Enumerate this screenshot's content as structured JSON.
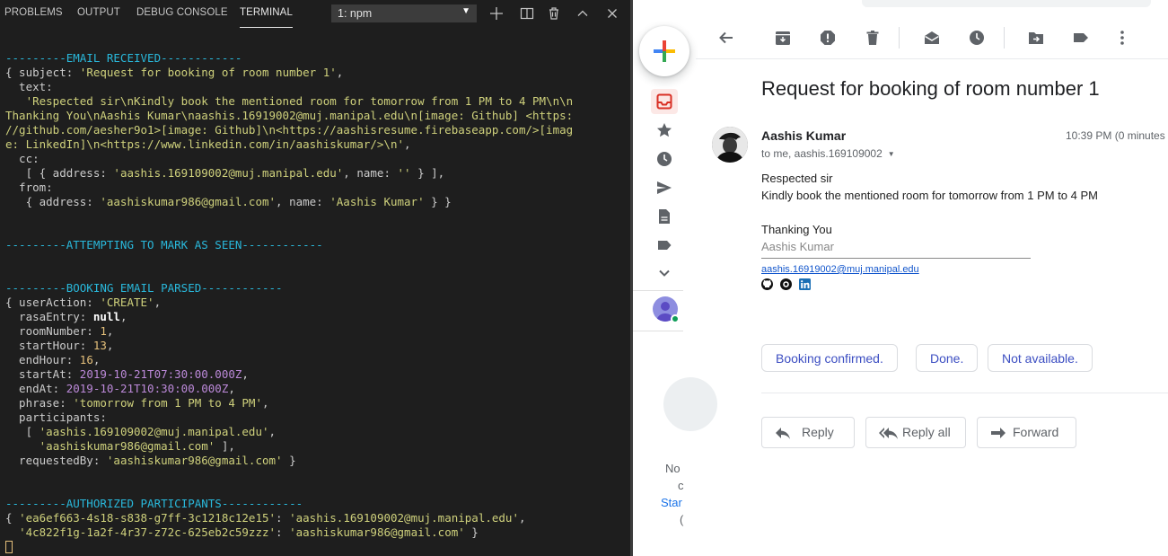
{
  "vscode": {
    "tabs": [
      "PROBLEMS",
      "OUTPUT",
      "DEBUG CONSOLE",
      "TERMINAL"
    ],
    "active_tab": "TERMINAL",
    "terminal_select": "1: npm",
    "actions": [
      "plus-icon",
      "split-icon",
      "trash-icon",
      "chevron-up-icon",
      "close-icon"
    ],
    "lines": [
      [
        {
          "t": "---------EMAIL RECEIVED------------",
          "c": "hdr"
        }
      ],
      [
        {
          "t": "{ subject: "
        },
        {
          "t": "'Request for booking of room number 1'",
          "c": "str"
        },
        {
          "t": ","
        }
      ],
      [
        {
          "t": "  text:"
        }
      ],
      [
        {
          "t": "   'Respected sir\\nKindly book the mentioned room for tomorrow from 1 PM to 4 PM\\n\\n",
          "c": "str"
        }
      ],
      [
        {
          "t": "Thanking You\\nAashis Kumar\\naashis.16919002@muj.manipal.edu\\n[image: Github] <https:",
          "c": "str"
        }
      ],
      [
        {
          "t": "//github.com/aesher9o1>[image: Github]\\n<https://aashisresume.firebaseapp.com/>[imag",
          "c": "str"
        }
      ],
      [
        {
          "t": "e: LinkedIn]\\n<https://www.linkedin.com/in/aashiskumar/>\\n'",
          "c": "str"
        },
        {
          "t": ","
        }
      ],
      [
        {
          "t": "  cc:"
        }
      ],
      [
        {
          "t": "   [ { address: "
        },
        {
          "t": "'aashis.169109002@muj.manipal.edu'",
          "c": "str"
        },
        {
          "t": ", name: "
        },
        {
          "t": "''",
          "c": "str"
        },
        {
          "t": " } ],"
        }
      ],
      [
        {
          "t": "  from:"
        }
      ],
      [
        {
          "t": "   { address: "
        },
        {
          "t": "'aashiskumar986@gmail.com'",
          "c": "str"
        },
        {
          "t": ", name: "
        },
        {
          "t": "'Aashis Kumar'",
          "c": "str"
        },
        {
          "t": " } }"
        }
      ],
      [],
      [],
      [
        {
          "t": "---------ATTEMPTING TO MARK AS SEEN------------",
          "c": "hdr"
        }
      ],
      [],
      [],
      [
        {
          "t": "---------BOOKING EMAIL PARSED------------",
          "c": "hdr"
        }
      ],
      [
        {
          "t": "{ userAction: "
        },
        {
          "t": "'CREATE'",
          "c": "str"
        },
        {
          "t": ","
        }
      ],
      [
        {
          "t": "  rasaEntry: "
        },
        {
          "t": "null",
          "c": "kw"
        },
        {
          "t": ","
        }
      ],
      [
        {
          "t": "  roomNumber: "
        },
        {
          "t": "1",
          "c": "num"
        },
        {
          "t": ","
        }
      ],
      [
        {
          "t": "  startHour: "
        },
        {
          "t": "13",
          "c": "num"
        },
        {
          "t": ","
        }
      ],
      [
        {
          "t": "  endHour: "
        },
        {
          "t": "16",
          "c": "num"
        },
        {
          "t": ","
        }
      ],
      [
        {
          "t": "  startAt: "
        },
        {
          "t": "2019-10-21T07:30:00.000Z",
          "c": "date"
        },
        {
          "t": ","
        }
      ],
      [
        {
          "t": "  endAt: "
        },
        {
          "t": "2019-10-21T10:30:00.000Z",
          "c": "date"
        },
        {
          "t": ","
        }
      ],
      [
        {
          "t": "  phrase: "
        },
        {
          "t": "'tomorrow from 1 PM to 4 PM'",
          "c": "str"
        },
        {
          "t": ","
        }
      ],
      [
        {
          "t": "  participants:"
        }
      ],
      [
        {
          "t": "   [ "
        },
        {
          "t": "'aashis.169109002@muj.manipal.edu'",
          "c": "str"
        },
        {
          "t": ","
        }
      ],
      [
        {
          "t": "     "
        },
        {
          "t": "'aashiskumar986@gmail.com'",
          "c": "str"
        },
        {
          "t": " ],"
        }
      ],
      [
        {
          "t": "  requestedBy: "
        },
        {
          "t": "'aashiskumar986@gmail.com'",
          "c": "str"
        },
        {
          "t": " }"
        }
      ],
      [],
      [],
      [
        {
          "t": "---------AUTHORIZED PARTICIPANTS------------",
          "c": "hdr"
        }
      ],
      [
        {
          "t": "{ "
        },
        {
          "t": "'ea6ef663-4s18-s838-g7ff-3c1218c12e15'",
          "c": "str"
        },
        {
          "t": ": "
        },
        {
          "t": "'aashis.169109002@muj.manipal.edu'",
          "c": "str"
        },
        {
          "t": ","
        }
      ],
      [
        {
          "t": "  "
        },
        {
          "t": "'4c822f1g-1a2f-4r37-z72c-625eb2c59zzz'",
          "c": "str"
        },
        {
          "t": ": "
        },
        {
          "t": "'aashiskumar986@gmail.com'",
          "c": "str"
        },
        {
          "t": " }"
        }
      ]
    ]
  },
  "gmail": {
    "rail": {
      "partial_text": [
        "No",
        "c",
        "Star",
        "("
      ]
    },
    "toolbar_icons": [
      "back-icon",
      "archive-icon",
      "report-spam-icon",
      "delete-icon",
      "mark-unread-icon",
      "snooze-icon",
      "move-to-icon",
      "label-icon",
      "more-icon"
    ],
    "subject": "Request for booking of room number 1",
    "sender": "Aashis Kumar",
    "time": "10:39 PM (0 minutes",
    "to": "to me, aashis.169109002",
    "body": {
      "line1": "Respected sir",
      "line2": "Kindly book the mentioned room for tomorrow from 1 PM to 4 PM",
      "line3": "Thanking You",
      "signature_name": "Aashis Kumar",
      "signature_email": "aashis.16919002@muj.manipal.edu"
    },
    "smart_replies": [
      "Booking confirmed.",
      "Done.",
      "Not available."
    ],
    "reply_buttons": {
      "reply": "Reply",
      "reply_all": "Reply all",
      "forward": "Forward"
    },
    "colors": {
      "accent": "#3c4ec2",
      "inbox_red": "#d93025"
    }
  }
}
